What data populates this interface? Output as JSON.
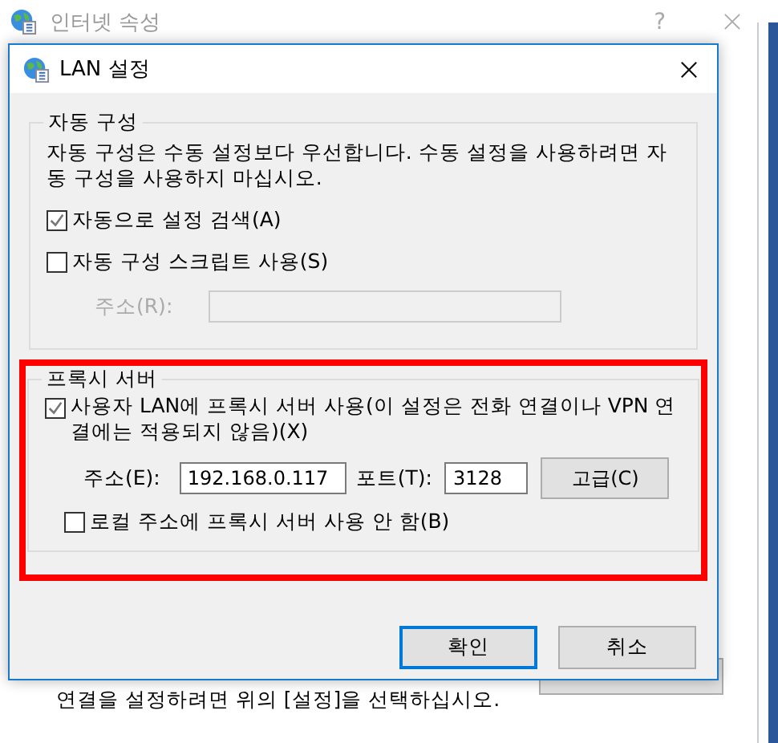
{
  "parent_window": {
    "title": "인터넷 속성",
    "help_button": "?",
    "hint": "연결을 설정하려면 위의 [설정]을 선택하십시오."
  },
  "dialog": {
    "title": "LAN 설정"
  },
  "auto_config": {
    "legend": "자동 구성",
    "description": "자동 구성은 수동 설정보다 우선합니다. 수동 설정을 사용하려면 자동 구성을 사용하지 마십시오.",
    "options": [
      {
        "label": "자동으로 설정 검색(A)",
        "checked": true
      },
      {
        "label": "자동 구성 스크립트 사용(S)",
        "checked": false
      }
    ],
    "address": {
      "label": "주소(R):",
      "disabled": true
    }
  },
  "proxy": {
    "legend": "프록시 서버",
    "highlighted": true,
    "use_proxy": {
      "label": "사용자 LAN에 프록시 서버 사용(이 설정은 전화 연결이나 VPN 연결에는 적용되지 않음)(X)",
      "checked": true
    },
    "address": {
      "label": "주소(E):",
      "value": "192.168.0.117"
    },
    "port": {
      "label": "포트(T):",
      "value": "3128"
    },
    "advanced_button": "고급(C)",
    "bypass_local": {
      "label": "로컬 주소에 프록시 서버 사용 안 함(B)",
      "checked": false
    }
  },
  "buttons": [
    {
      "label": "확인",
      "default": true
    },
    {
      "label": "취소",
      "default": false
    }
  ]
}
